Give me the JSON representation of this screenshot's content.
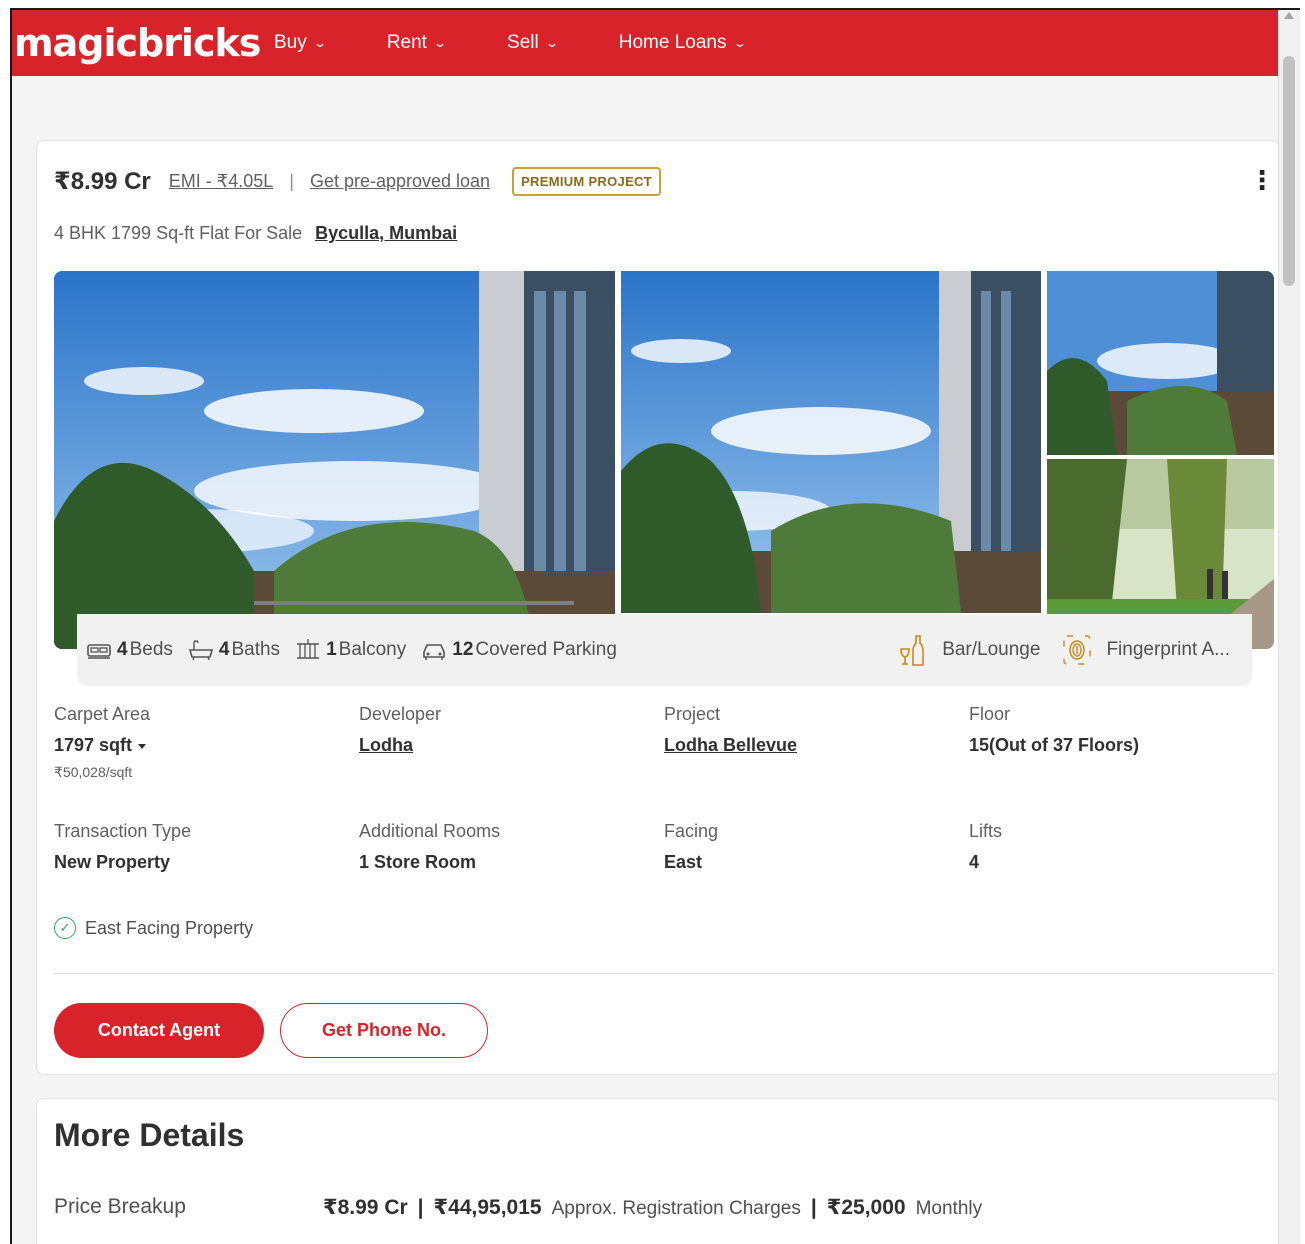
{
  "header": {
    "logo": "magicbricks",
    "nav": [
      {
        "label": "Buy"
      },
      {
        "label": "Rent"
      },
      {
        "label": "Sell"
      },
      {
        "label": "Home Loans"
      }
    ]
  },
  "listing": {
    "price": "₹8.99 Cr",
    "emi": "EMI - ₹4.05L",
    "separator": "|",
    "preapproved_link": "Get pre-approved loan",
    "badge": "PREMIUM PROJECT",
    "title": "4 BHK 1799 Sq-ft Flat For Sale",
    "location": "Byculla, Mumbai",
    "highlights": {
      "beds_count": "4",
      "beds_label": "Beds",
      "baths_count": "4",
      "baths_label": "Baths",
      "balcony_count": "1",
      "balcony_label": "Balcony",
      "parking_count": "12",
      "parking_label": "Covered Parking"
    },
    "amenities": [
      {
        "label": "Bar/Lounge",
        "icon": "bar-lounge-icon"
      },
      {
        "label": "Fingerprint A...",
        "icon": "fingerprint-icon"
      }
    ],
    "details": {
      "carpet_area_label": "Carpet Area",
      "carpet_area_value": "1797 sqft",
      "carpet_area_rate": "₹50,028/sqft",
      "developer_label": "Developer",
      "developer_value": "Lodha",
      "project_label": "Project",
      "project_value": "Lodha Bellevue",
      "floor_label": "Floor",
      "floor_value": "15(Out of 37 Floors)",
      "transaction_label": "Transaction Type",
      "transaction_value": "New Property",
      "rooms_label": "Additional Rooms",
      "rooms_value": "1 Store Room",
      "facing_label": "Facing",
      "facing_value": "East",
      "lifts_label": "Lifts",
      "lifts_value": "4"
    },
    "feature": "East Facing Property",
    "buttons": {
      "contact": "Contact Agent",
      "phone": "Get Phone No."
    }
  },
  "more_details": {
    "title": "More Details",
    "price_breakup_label": "Price Breakup",
    "price_value": "₹8.99 Cr",
    "registration_value": "₹44,95,015",
    "registration_label": "Approx. Registration Charges",
    "monthly_value": "₹25,000",
    "monthly_label": "Monthly",
    "divider": "|"
  },
  "colors": {
    "brand_red": "#d8232a",
    "premium_gold": "#caa03a",
    "check_green": "#2fa36b"
  }
}
